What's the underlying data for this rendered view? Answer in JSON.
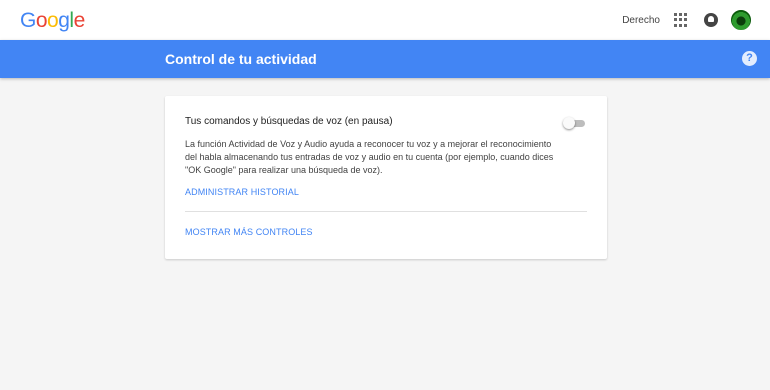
{
  "logo": {
    "letters": [
      "G",
      "o",
      "o",
      "g",
      "l",
      "e"
    ],
    "colors": [
      "#4285f4",
      "#ea4335",
      "#fbbc05",
      "#4285f4",
      "#34a853",
      "#ea4335"
    ]
  },
  "header": {
    "user_label": "Derecho",
    "apps_icon": "apps-grid-icon",
    "notifications_icon": "notifications-icon",
    "avatar": "account-avatar"
  },
  "banner": {
    "title": "Control de tu actividad",
    "help_symbol": "?",
    "background": "#4285f4"
  },
  "card": {
    "title": "Tus comandos y búsquedas de voz (en pausa)",
    "toggle_state": "off",
    "description": "La función Actividad de Voz y Audio ayuda a reconocer tu voz y a mejorar el reconocimiento del habla almacenando tus entradas de voz y audio en tu cuenta (por ejemplo, cuando dices \"OK Google\" para realizar una búsqueda de voz).",
    "manage_link": "ADMINISTRAR HISTORIAL",
    "more_link": "MOSTRAR MÁS CONTROLES"
  }
}
